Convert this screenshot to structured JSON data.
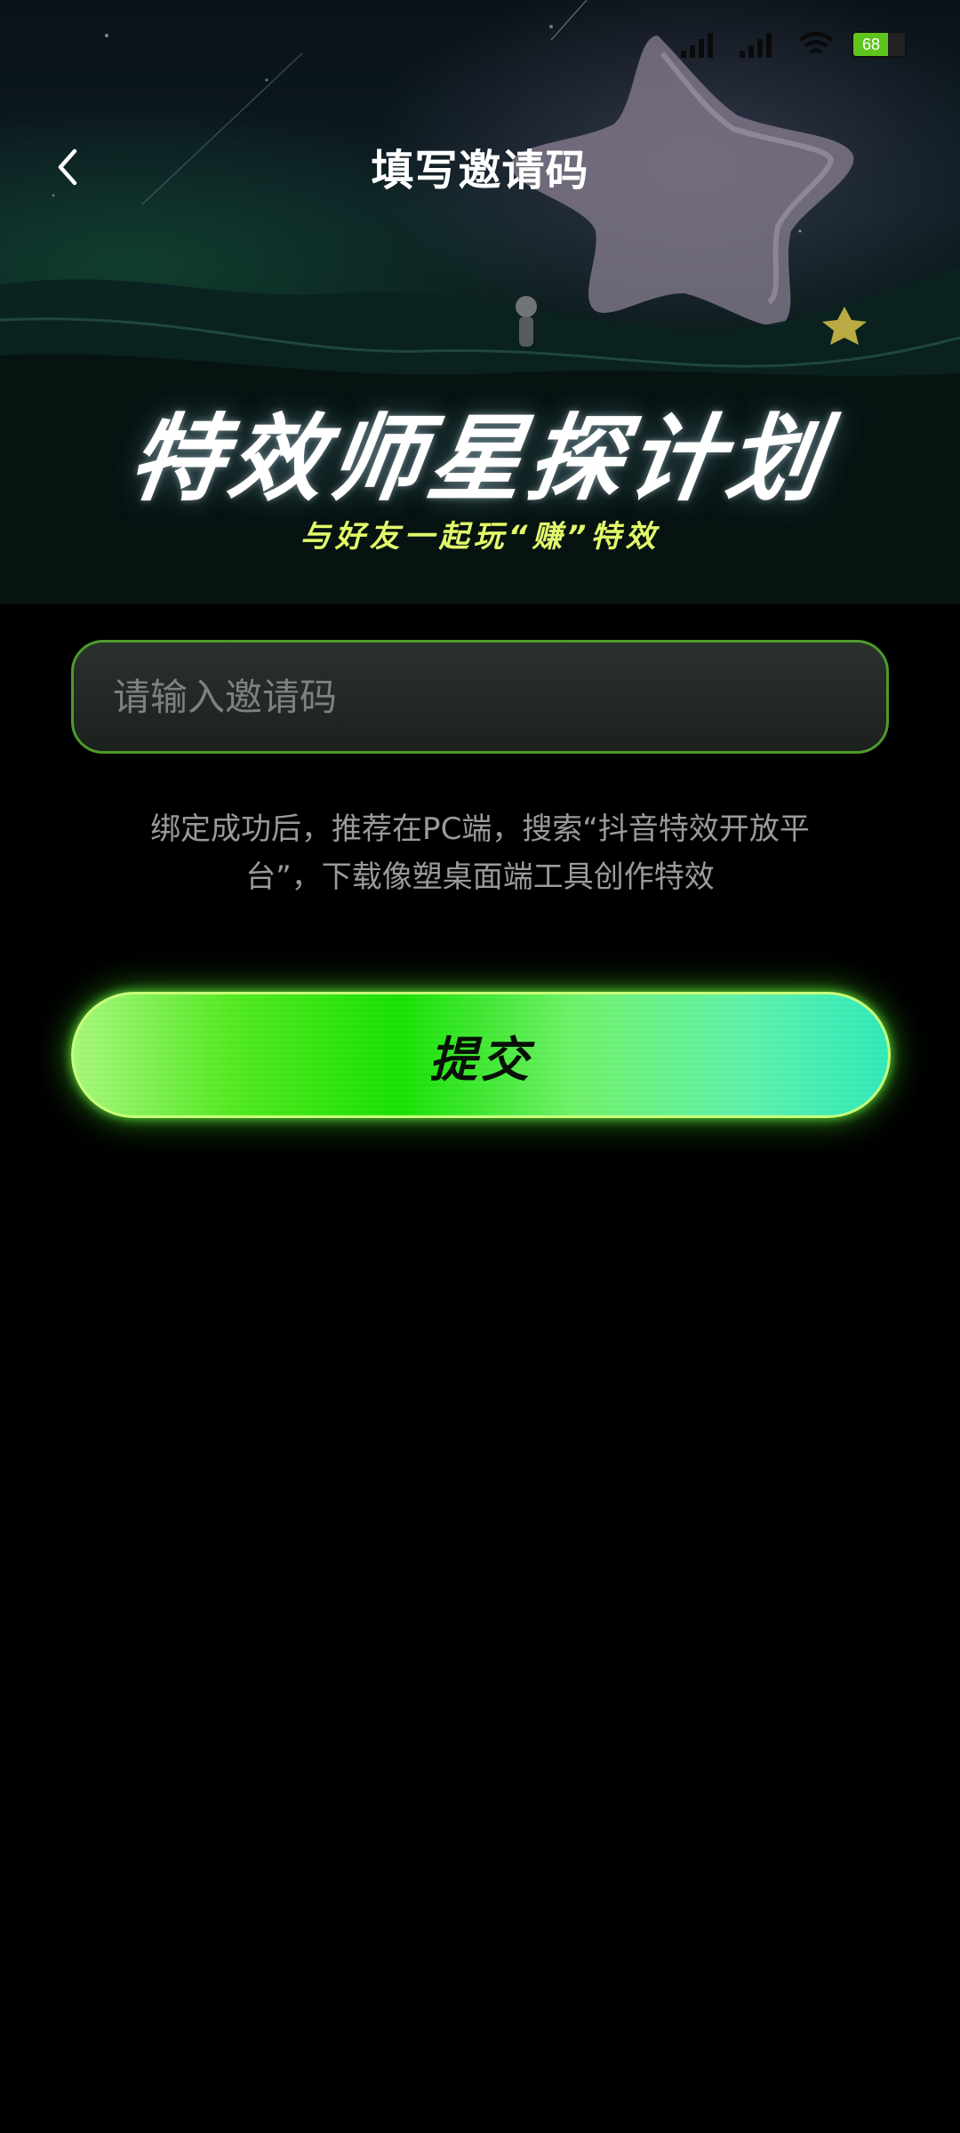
{
  "status_bar": {
    "battery_level": "68",
    "signal_icon": "signal-bars-icon",
    "wifi_icon": "wifi-icon",
    "battery_icon": "battery-icon"
  },
  "header": {
    "title": "填写邀请码",
    "back_icon": "chevron-left-icon"
  },
  "campaign": {
    "title": "特效师星探计划",
    "subtitle": "与好友一起玩“赚”特效"
  },
  "form": {
    "invite_placeholder": "请输入邀请码",
    "invite_value": "",
    "hint": "绑定成功后，推荐在PC端，搜索“抖音特效开放平台”，下载像塑桌面端工具创作特效",
    "submit_label": "提交"
  },
  "colors": {
    "accent_green": "#16e000",
    "subtitle_yellow": "#e2f86a",
    "input_border": "#4e9a2a",
    "background": "#000000"
  }
}
